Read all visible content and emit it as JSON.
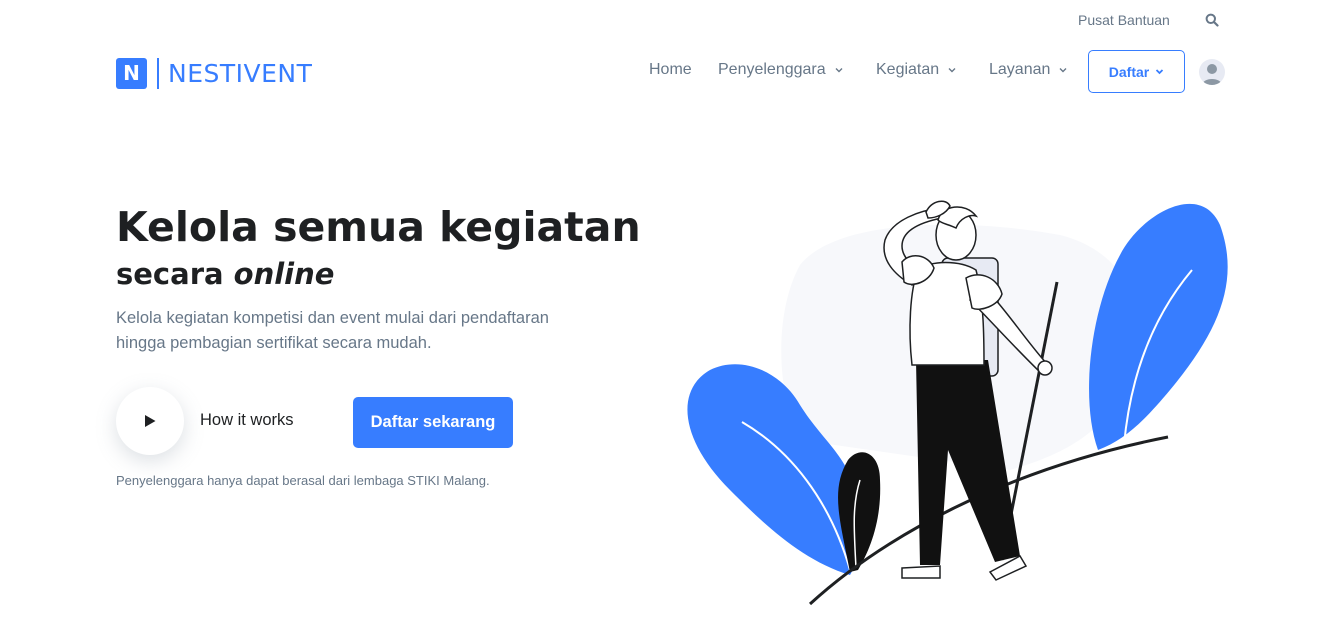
{
  "topbar": {
    "help_label": "Pusat Bantuan",
    "search_icon": "search-icon"
  },
  "brand": {
    "mark": "N",
    "name": "NESTIVENT",
    "color": "#377dff"
  },
  "nav": {
    "items": [
      {
        "label": "Home",
        "has_dropdown": false
      },
      {
        "label": "Penyelenggara",
        "has_dropdown": true
      },
      {
        "label": "Kegiatan",
        "has_dropdown": true
      },
      {
        "label": "Layanan",
        "has_dropdown": true
      }
    ],
    "signup_label": "Daftar",
    "avatar_icon": "user-avatar-icon"
  },
  "hero": {
    "title": "Kelola semua kegiatan",
    "subtitle_prefix": "secara",
    "subtitle_emphasis": "online",
    "description": "Kelola kegiatan kompetisi dan event mulai dari pendaftaran hingga pembagian sertifikat secara mudah.",
    "video_label": "How it works",
    "cta_label": "Daftar sekarang",
    "note": "Penyelenggara hanya dapat berasal dari lembaga STIKI Malang."
  },
  "colors": {
    "primary": "#377dff",
    "text": "#1e2022",
    "muted": "#677788"
  }
}
